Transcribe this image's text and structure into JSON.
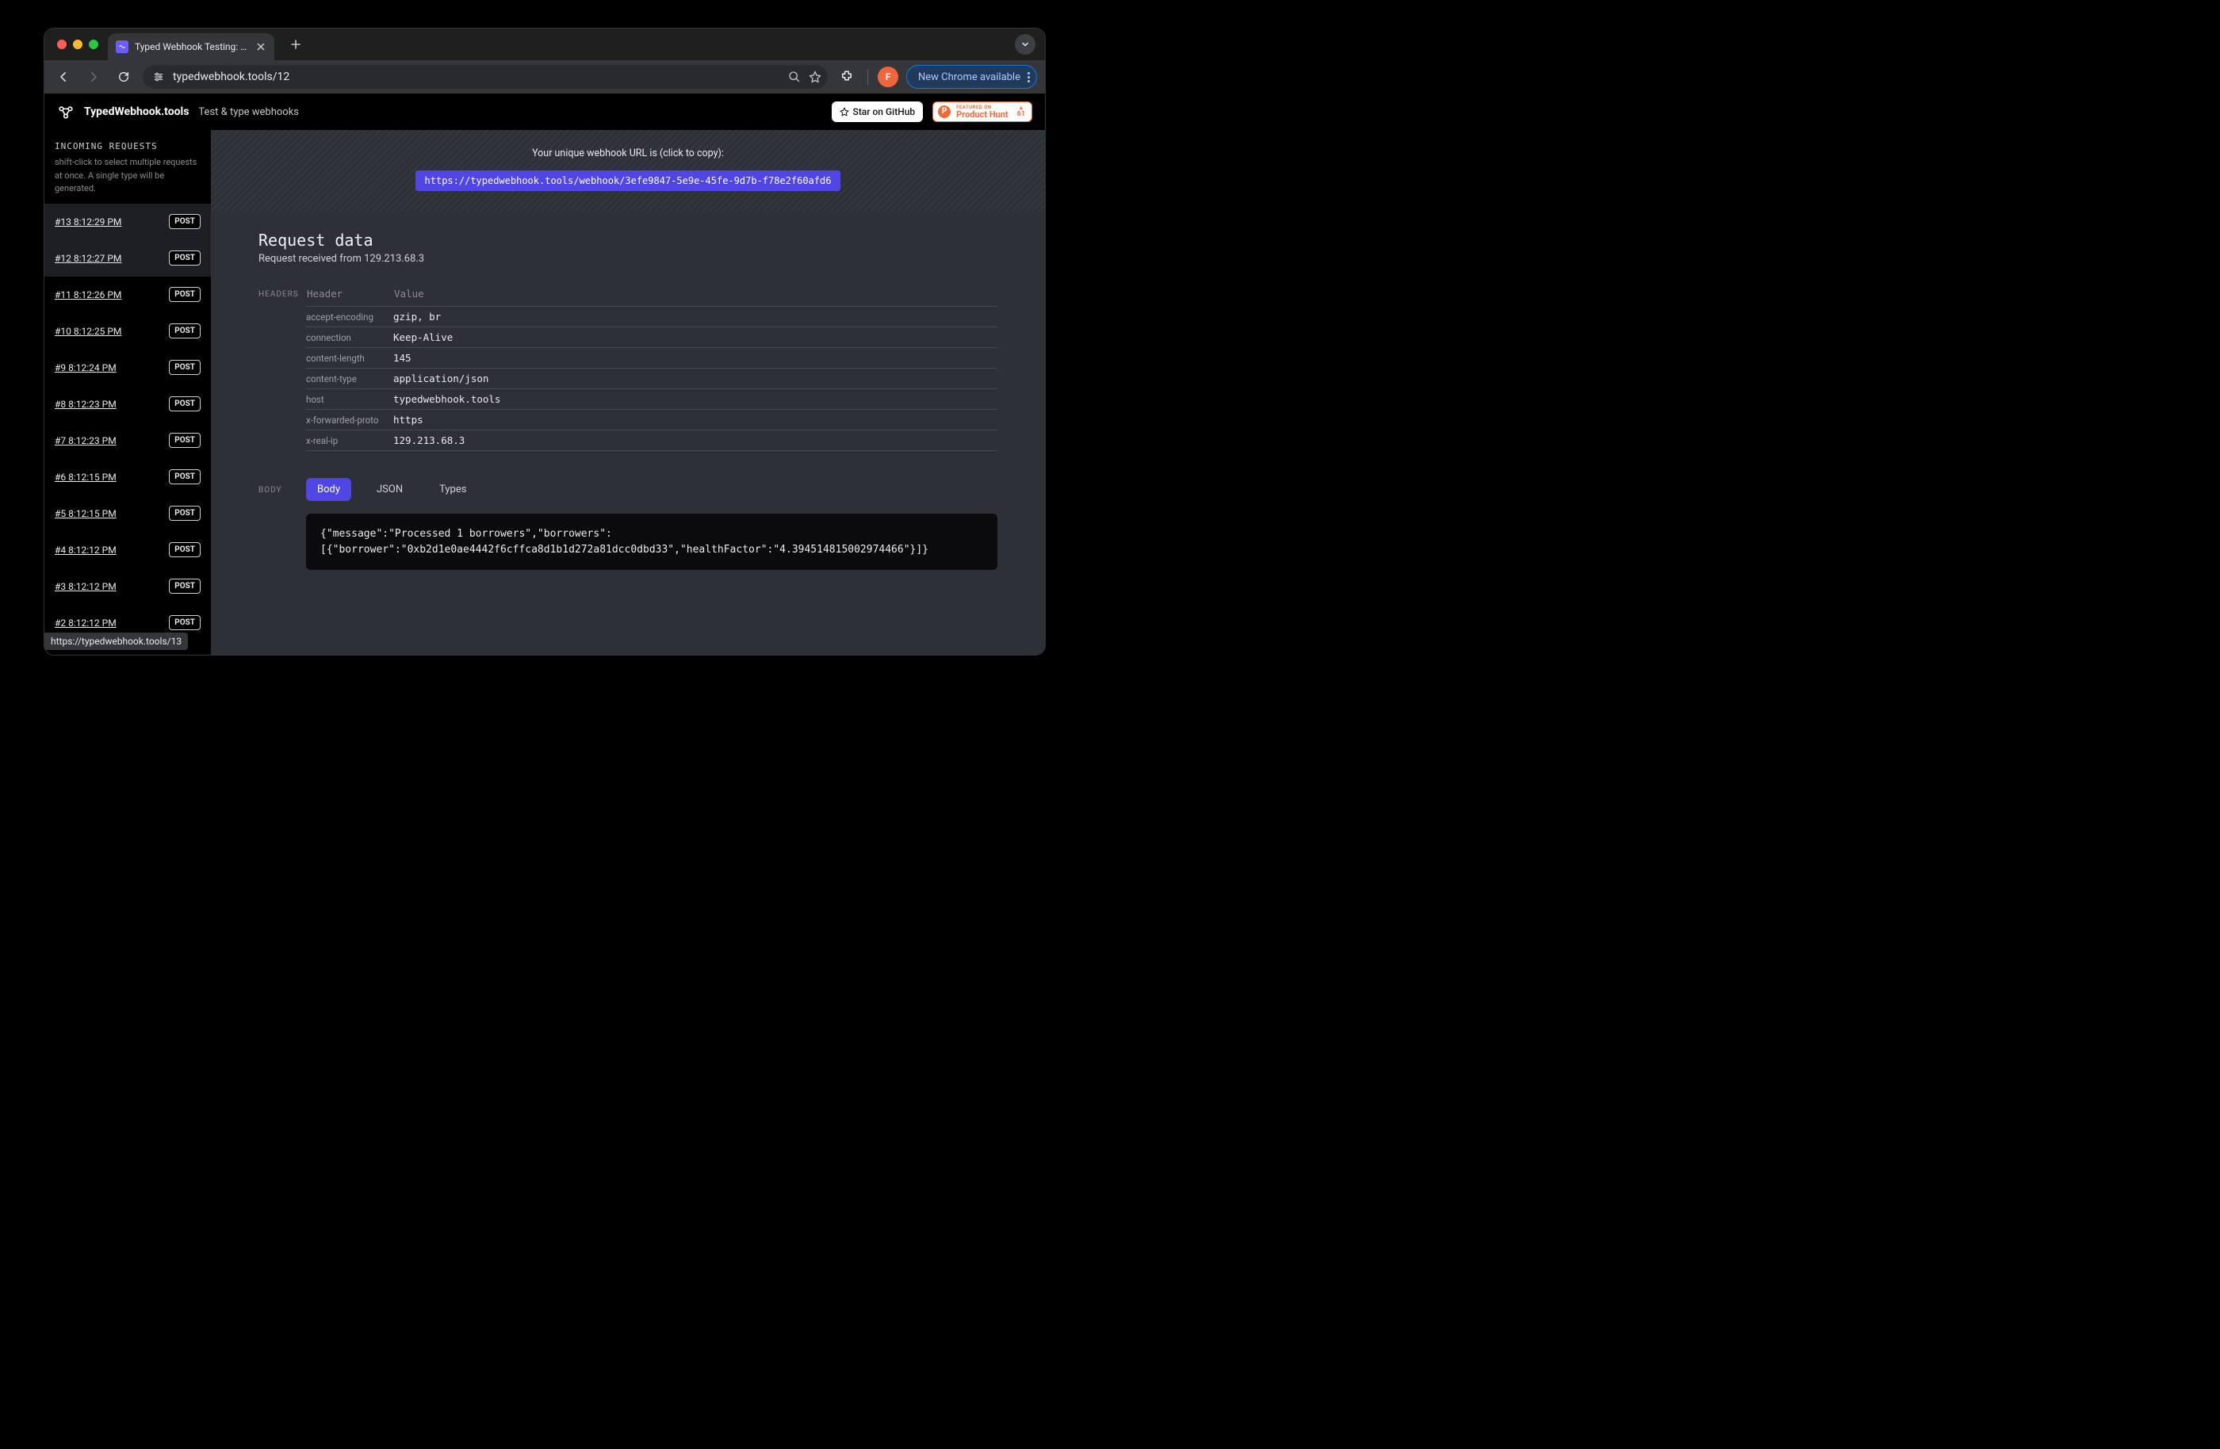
{
  "browser": {
    "tab_title": "Typed Webhook Testing: a to…",
    "url": "typedwebhook.tools/12",
    "update_label": "New Chrome available",
    "profile_initial": "F"
  },
  "app_header": {
    "title": "TypedWebhook.tools",
    "subtitle": "Test & type webhooks",
    "github_label": "Star on GitHub",
    "ph_line1": "FEATURED ON",
    "ph_line2": "Product Hunt",
    "ph_votes": "61"
  },
  "sidebar": {
    "title": "INCOMING REQUESTS",
    "help": "shift-click to select multiple requests at once. A single type will be generated.",
    "requests": [
      {
        "id": "#13",
        "time": "8:12:29 PM",
        "method": "POST",
        "selected": true
      },
      {
        "id": "#12",
        "time": "8:12:27 PM",
        "method": "POST",
        "selected": true
      },
      {
        "id": "#11",
        "time": "8:12:26 PM",
        "method": "POST",
        "selected": false
      },
      {
        "id": "#10",
        "time": "8:12:25 PM",
        "method": "POST",
        "selected": false
      },
      {
        "id": "#9",
        "time": "8:12:24 PM",
        "method": "POST",
        "selected": false
      },
      {
        "id": "#8",
        "time": "8:12:23 PM",
        "method": "POST",
        "selected": false
      },
      {
        "id": "#7",
        "time": "8:12:23 PM",
        "method": "POST",
        "selected": false
      },
      {
        "id": "#6",
        "time": "8:12:15 PM",
        "method": "POST",
        "selected": false
      },
      {
        "id": "#5",
        "time": "8:12:15 PM",
        "method": "POST",
        "selected": false
      },
      {
        "id": "#4",
        "time": "8:12:12 PM",
        "method": "POST",
        "selected": false
      },
      {
        "id": "#3",
        "time": "8:12:12 PM",
        "method": "POST",
        "selected": false
      },
      {
        "id": "#2",
        "time": "8:12:12 PM",
        "method": "POST",
        "selected": false
      }
    ],
    "link_preview": "https://typedwebhook.tools/13"
  },
  "main": {
    "banner_label": "Your unique webhook URL is (click to copy):",
    "webhook_url": "https://typedwebhook.tools/webhook/3efe9847-5e9e-45fe-9d7b-f78e2f60afd6",
    "title": "Request data",
    "subtitle": "Request received from 129.213.68.3",
    "headers_label": "HEADERS",
    "headers_th_header": "Header",
    "headers_th_value": "Value",
    "headers": [
      {
        "name": "accept-encoding",
        "value": "gzip, br"
      },
      {
        "name": "connection",
        "value": "Keep-Alive"
      },
      {
        "name": "content-length",
        "value": "145"
      },
      {
        "name": "content-type",
        "value": "application/json"
      },
      {
        "name": "host",
        "value": "typedwebhook.tools"
      },
      {
        "name": "x-forwarded-proto",
        "value": "https"
      },
      {
        "name": "x-real-ip",
        "value": "129.213.68.3"
      }
    ],
    "body_label": "BODY",
    "body_tabs": [
      {
        "key": "body",
        "label": "Body",
        "active": true
      },
      {
        "key": "json",
        "label": "JSON",
        "active": false
      },
      {
        "key": "types",
        "label": "Types",
        "active": false
      }
    ],
    "body_text": "{\"message\":\"Processed 1 borrowers\",\"borrowers\":\n[{\"borrower\":\"0xb2d1e0ae4442f6cffca8d1b1d272a81dcc0dbd33\",\"healthFactor\":\"4.394514815002974466\"}]}"
  }
}
